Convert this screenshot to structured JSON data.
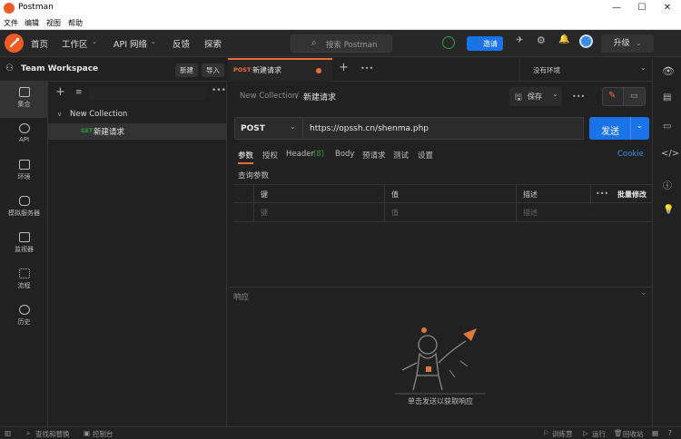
{
  "titlebar": {
    "title": "Postman",
    "minimize": "—",
    "maximize": "☐",
    "close": "✕"
  },
  "menubar": {
    "items": [
      "文件",
      "编辑",
      "视图",
      "帮助"
    ]
  },
  "topnav": {
    "links": [
      {
        "label": "首页"
      },
      {
        "label": "工作区"
      },
      {
        "label": "API 网络"
      },
      {
        "label": "反馈"
      },
      {
        "label": "探索"
      }
    ],
    "search_placeholder": "搜索 Postman",
    "invite_label": "邀请",
    "upgrade_label": "升级"
  },
  "workspace": {
    "name": "Team Workspace",
    "new_label": "新建",
    "import_label": "导入"
  },
  "leftrail": {
    "items": [
      {
        "label": "集合",
        "icon": "collections-icon",
        "active": true
      },
      {
        "label": "API",
        "icon": "api-icon"
      },
      {
        "label": "环境",
        "icon": "environments-icon"
      },
      {
        "label": "模拟服务器",
        "icon": "mock-servers-icon"
      },
      {
        "label": "监视器",
        "icon": "monitors-icon"
      },
      {
        "label": "流程",
        "icon": "flows-icon"
      },
      {
        "label": "历史",
        "icon": "history-icon"
      }
    ]
  },
  "tree": {
    "collection_name": "New Collection",
    "request_method": "GET",
    "request_name": "新建请求"
  },
  "tabs": {
    "active_method": "POST",
    "active_name": "新建请求",
    "environment": "没有环境"
  },
  "breadcrumb": {
    "collection": "New Collection",
    "separator": "/",
    "request": "新建请求"
  },
  "toolbar": {
    "save_label": "保存"
  },
  "request": {
    "method": "POST",
    "url": "https://opssh.cn/shenma.php",
    "send_label": "发送"
  },
  "request_tabs": {
    "items": [
      {
        "label": "参数",
        "active": true
      },
      {
        "label": "授权"
      },
      {
        "label": "Header"
      },
      {
        "label": "Body"
      },
      {
        "label": "预请求"
      },
      {
        "label": "测试"
      },
      {
        "label": "设置"
      }
    ],
    "header_count": "(8)",
    "cookie_label": "Cookie"
  },
  "params": {
    "section_title": "查询参数",
    "columns": [
      "键",
      "值",
      "描述"
    ],
    "bulk_edit": "批量修改",
    "placeholder_row": [
      "键",
      "值",
      "描述"
    ]
  },
  "response": {
    "title": "响应",
    "empty_hint": "单击发送以获取响应"
  },
  "statusbar": {
    "find_replace": "查找和替换",
    "console": "控制台",
    "bootcamp": "训练营",
    "runner": "运行",
    "trash": "回收站"
  },
  "colors": {
    "accent_orange": "#f26b3a",
    "brand_blue": "#1a73e8",
    "get_green": "#2f9e44"
  }
}
